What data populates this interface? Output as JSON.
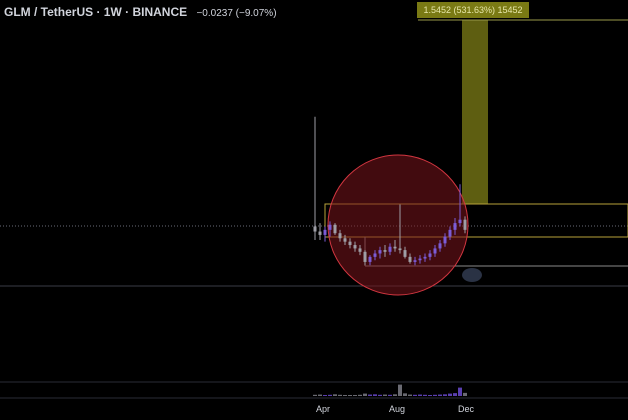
{
  "header": {
    "symbol": "GLM / TetherUS · 1W · BINANCE",
    "change": "−0.0237 (−9.07%)"
  },
  "measure": {
    "label": "1.5452 (531.63%) 15452"
  },
  "colors": {
    "up": "#7b5bd6",
    "down": "#9e9ea6",
    "circle": "#c8323c",
    "box": "#b8a23a",
    "measure": "#7a7a14"
  },
  "chart_data": {
    "type": "candlestick",
    "interval": "1W",
    "x_ticks": [
      "Apr",
      "Aug",
      "Dec"
    ],
    "series": [
      {
        "candles": [
          {
            "o": 0.3,
            "h": 0.95,
            "l": 0.22,
            "c": 0.27
          },
          {
            "o": 0.27,
            "h": 0.32,
            "l": 0.22,
            "c": 0.25
          },
          {
            "o": 0.25,
            "h": 0.3,
            "l": 0.21,
            "c": 0.28
          },
          {
            "o": 0.28,
            "h": 0.33,
            "l": 0.24,
            "c": 0.31
          },
          {
            "o": 0.31,
            "h": 0.32,
            "l": 0.25,
            "c": 0.26
          },
          {
            "o": 0.26,
            "h": 0.28,
            "l": 0.21,
            "c": 0.23
          },
          {
            "o": 0.23,
            "h": 0.25,
            "l": 0.19,
            "c": 0.21
          },
          {
            "o": 0.21,
            "h": 0.23,
            "l": 0.17,
            "c": 0.19
          },
          {
            "o": 0.19,
            "h": 0.21,
            "l": 0.15,
            "c": 0.17
          },
          {
            "o": 0.17,
            "h": 0.19,
            "l": 0.13,
            "c": 0.15
          },
          {
            "o": 0.15,
            "h": 0.16,
            "l": 0.07,
            "c": 0.09
          },
          {
            "o": 0.09,
            "h": 0.13,
            "l": 0.07,
            "c": 0.12
          },
          {
            "o": 0.12,
            "h": 0.16,
            "l": 0.1,
            "c": 0.14
          },
          {
            "o": 0.14,
            "h": 0.18,
            "l": 0.11,
            "c": 0.16
          },
          {
            "o": 0.16,
            "h": 0.19,
            "l": 0.12,
            "c": 0.15
          },
          {
            "o": 0.15,
            "h": 0.2,
            "l": 0.13,
            "c": 0.18
          },
          {
            "o": 0.18,
            "h": 0.22,
            "l": 0.15,
            "c": 0.17
          },
          {
            "o": 0.17,
            "h": 0.43,
            "l": 0.14,
            "c": 0.16
          },
          {
            "o": 0.16,
            "h": 0.18,
            "l": 0.11,
            "c": 0.12
          },
          {
            "o": 0.12,
            "h": 0.14,
            "l": 0.08,
            "c": 0.09
          },
          {
            "o": 0.09,
            "h": 0.12,
            "l": 0.07,
            "c": 0.1
          },
          {
            "o": 0.1,
            "h": 0.13,
            "l": 0.08,
            "c": 0.11
          },
          {
            "o": 0.11,
            "h": 0.14,
            "l": 0.09,
            "c": 0.12
          },
          {
            "o": 0.12,
            "h": 0.16,
            "l": 0.1,
            "c": 0.14
          },
          {
            "o": 0.14,
            "h": 0.19,
            "l": 0.12,
            "c": 0.17
          },
          {
            "o": 0.17,
            "h": 0.22,
            "l": 0.15,
            "c": 0.2
          },
          {
            "o": 0.2,
            "h": 0.26,
            "l": 0.18,
            "c": 0.24
          },
          {
            "o": 0.24,
            "h": 0.3,
            "l": 0.22,
            "c": 0.28
          },
          {
            "o": 0.28,
            "h": 0.35,
            "l": 0.25,
            "c": 0.32
          },
          {
            "o": 0.32,
            "h": 0.55,
            "l": 0.3,
            "c": 0.34
          },
          {
            "o": 0.34,
            "h": 0.36,
            "l": 0.26,
            "c": 0.28
          }
        ]
      }
    ],
    "volume": [
      0.1,
      0.12,
      0.08,
      0.1,
      0.14,
      0.1,
      0.08,
      0.06,
      0.08,
      0.1,
      0.2,
      0.12,
      0.14,
      0.1,
      0.12,
      0.1,
      0.14,
      0.95,
      0.22,
      0.12,
      0.1,
      0.12,
      0.1,
      0.08,
      0.1,
      0.12,
      0.14,
      0.2,
      0.24,
      0.7,
      0.26
    ]
  }
}
